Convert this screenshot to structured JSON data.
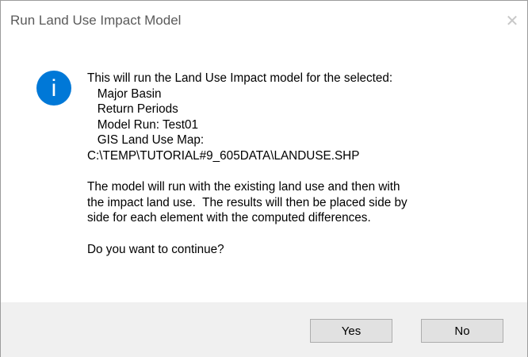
{
  "window": {
    "title": "Run Land Use Impact Model",
    "close_glyph": "✕"
  },
  "icon": {
    "name": "info-icon",
    "glyph": "i",
    "color": "#0078d7"
  },
  "message": {
    "lines": [
      "This will run the Land Use Impact model for the selected:",
      "   Major Basin",
      "   Return Periods",
      "   Model Run: Test01",
      "   GIS Land Use Map:",
      "C:\\TEMP\\TUTORIAL#9_605DATA\\LANDUSE.SHP",
      "",
      "The model will run with the existing land use and then with",
      "the impact land use.  The results will then be placed side by",
      "side for each element with the computed differences.",
      "",
      "Do you want to continue?"
    ]
  },
  "buttons": {
    "yes_label": "Yes",
    "no_label": "No"
  }
}
